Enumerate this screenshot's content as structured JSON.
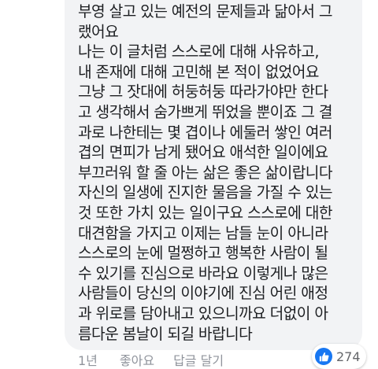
{
  "comment": {
    "lines": [
      "부영 살고 있는 예전의 문제들과 닮아서 그",
      "랬어요",
      "나는 이 글처럼 스스로에 대해 사유하고,",
      "내 존재에 대해 고민해 본 적이 없었어요",
      "그냥 그 잣대에 허둥허둥 따라가야만 한다",
      "고 생각해서 숨가쁘게 뛰었을 뿐이죠 그 결",
      "과로 나한테는 몇 겹이나 에둘러 쌓인 여러",
      "겹의 면피가 남게 됐어요 애석한 일이에요",
      "부끄러워 할 줄 아는 삶은 좋은 삶이랍니다",
      "자신의 일생에 진지한 물음을 가질 수 있는",
      "것 또한 가치 있는 일이구요 스스로에 대한",
      "대견함을 가지고 이제는 남들 눈이 아니라",
      "스스로의 눈에 멀쩡하고 행복한 사람이 될",
      "수 있기를 진심으로 바라요 이렇게나 많은",
      "사람들이 당신의 이야기에 진심 어린 애정",
      "과 위로를 담아내고 있으니까요 더없이 아",
      "름다운 봄날이 되길 바랍니다"
    ]
  },
  "footer": {
    "timestamp": "1년",
    "like_label": "좋아요",
    "reply_label": "답글 달기"
  },
  "reactions": {
    "count": "274",
    "icon": "thumbs-up-icon",
    "badge_color": "#1877f2"
  }
}
